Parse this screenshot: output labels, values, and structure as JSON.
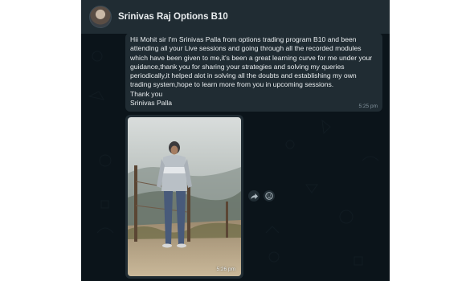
{
  "chat": {
    "contact_name": "Srinivas Raj Options B10"
  },
  "messages": [
    {
      "text": "Hii Mohit sir I'm Srinivas Palla from options trading program B10 and been\nattending all your Live sessions and going through all the recorded modules\nwhich have been given to me,it's been a great learning curve for me under your\nguidance,thank you for sharing your strategies and solving my queries\nperiodically,it helped alot in solving all the doubts and establishing my own\ntrading system,hope to learn more from you in upcoming sessions.\nThank you\nSrinivas Palla",
      "time": "5:25 pm"
    },
    {
      "time": "5:26 pm"
    }
  ],
  "icons": {
    "avatar": "avatar-photo",
    "forward": "forward-icon",
    "react": "emoji-icon"
  },
  "colors": {
    "background": "#0b141a",
    "header": "#202c33",
    "bubble": "#202c33",
    "text": "#e9edef",
    "meta": "#8696a0"
  }
}
